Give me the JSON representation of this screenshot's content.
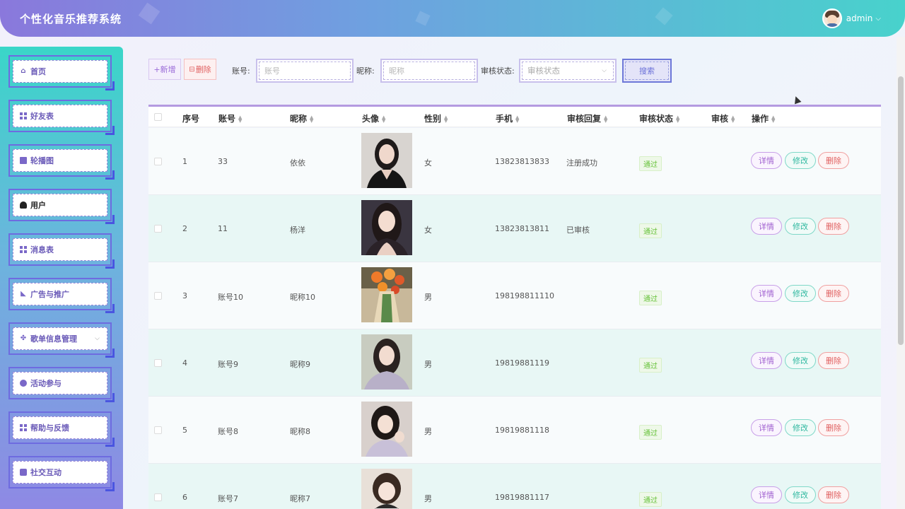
{
  "header": {
    "title": "个性化音乐推荐系统",
    "user": "admin"
  },
  "sidebar": {
    "items": [
      {
        "label": "首页",
        "icon": "home-icon"
      },
      {
        "label": "好友表",
        "icon": "grid-icon"
      },
      {
        "label": "轮播图",
        "icon": "carousel-icon"
      },
      {
        "label": "用户",
        "icon": "user-icon",
        "active": true
      },
      {
        "label": "消息表",
        "icon": "grid-icon"
      },
      {
        "label": "广告与推广",
        "icon": "ad-icon"
      },
      {
        "label": "歌单信息管理",
        "icon": "apps-icon",
        "has_submenu": true
      },
      {
        "label": "活动参与",
        "icon": "activity-icon"
      },
      {
        "label": "帮助与反馈",
        "icon": "grid-icon"
      },
      {
        "label": "社交互动",
        "icon": "social-icon"
      }
    ]
  },
  "toolbar": {
    "add_label": "+新增",
    "delete_label": "删除",
    "account_label": "账号:",
    "account_placeholder": "账号",
    "nickname_label": "昵称:",
    "nickname_placeholder": "昵称",
    "status_label": "审核状态:",
    "status_placeholder": "审核状态",
    "search_label": "搜索"
  },
  "table": {
    "columns": [
      "序号",
      "账号",
      "昵称",
      "头像",
      "性别",
      "手机",
      "审核回复",
      "审核状态",
      "审核",
      "操作"
    ],
    "rows": [
      {
        "no": "1",
        "account": "33",
        "nickname": "依依",
        "gender": "女",
        "phone": "13823813833",
        "reply": "注册成功",
        "status": "通过"
      },
      {
        "no": "2",
        "account": "11",
        "nickname": "杨洋",
        "gender": "女",
        "phone": "13823813811",
        "reply": "已审核",
        "status": "通过"
      },
      {
        "no": "3",
        "account": "账号10",
        "nickname": "昵称10",
        "gender": "男",
        "phone": "198198811110",
        "reply": "",
        "status": "通过"
      },
      {
        "no": "4",
        "account": "账号9",
        "nickname": "昵称9",
        "gender": "男",
        "phone": "19819881119",
        "reply": "",
        "status": "通过"
      },
      {
        "no": "5",
        "account": "账号8",
        "nickname": "昵称8",
        "gender": "男",
        "phone": "19819881118",
        "reply": "",
        "status": "通过"
      },
      {
        "no": "6",
        "account": "账号7",
        "nickname": "昵称7",
        "gender": "男",
        "phone": "19819881117",
        "reply": "",
        "status": "通过"
      }
    ],
    "actions": {
      "detail": "详情",
      "edit": "修改",
      "delete": "删除"
    }
  },
  "colors": {
    "header_start": "#8a78dc",
    "header_end": "#48d2cc",
    "sidebar_top": "#3ad6c8",
    "sidebar_bottom": "#8f88e4",
    "pass_green": "#67c23a"
  }
}
